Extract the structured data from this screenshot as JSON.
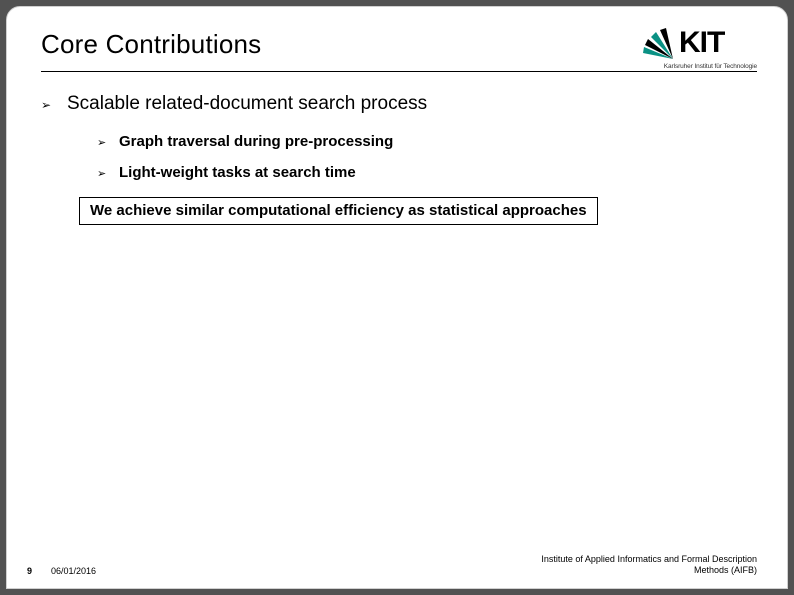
{
  "title": "Core Contributions",
  "logo": {
    "text": "KIT",
    "sub": "Karlsruher Institut für Technologie"
  },
  "main_bullet": "Scalable related-document search process",
  "sub_bullets": [
    "Graph traversal during pre-processing",
    "Light-weight tasks at search time"
  ],
  "callout": "We achieve similar computational efficiency as statistical approaches",
  "footer": {
    "page": "9",
    "date": "06/01/2016",
    "institute_line1": "Institute of Applied Informatics and Formal Description",
    "institute_line2": "Methods (AIFB)"
  }
}
